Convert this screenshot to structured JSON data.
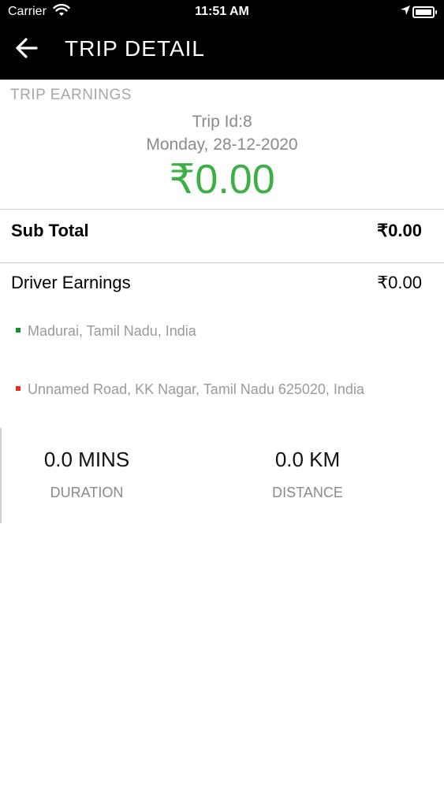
{
  "status_bar": {
    "carrier": "Carrier",
    "time": "11:51 AM"
  },
  "header": {
    "title": "TRIP DETAIL"
  },
  "earnings": {
    "section_label": "TRIP EARNINGS",
    "trip_id": "Trip Id:8",
    "date": "Monday, 28-12-2020",
    "amount": "₹0.00",
    "amount_color": "#3cb043"
  },
  "sub_total": {
    "label": "Sub Total",
    "value": "₹0.00"
  },
  "driver_earnings": {
    "label": "Driver Earnings",
    "value": "₹0.00"
  },
  "locations": {
    "pickup": "Madurai, Tamil Nadu, India",
    "pickup_color": "#1e8a2e",
    "drop": "Unnamed Road, KK Nagar, Tamil Nadu 625020, India",
    "drop_color": "#e0301e"
  },
  "stats": {
    "duration_value": "0.0 MINS",
    "duration_label": "DURATION",
    "distance_value": "0.0 KM",
    "distance_label": "DISTANCE"
  }
}
